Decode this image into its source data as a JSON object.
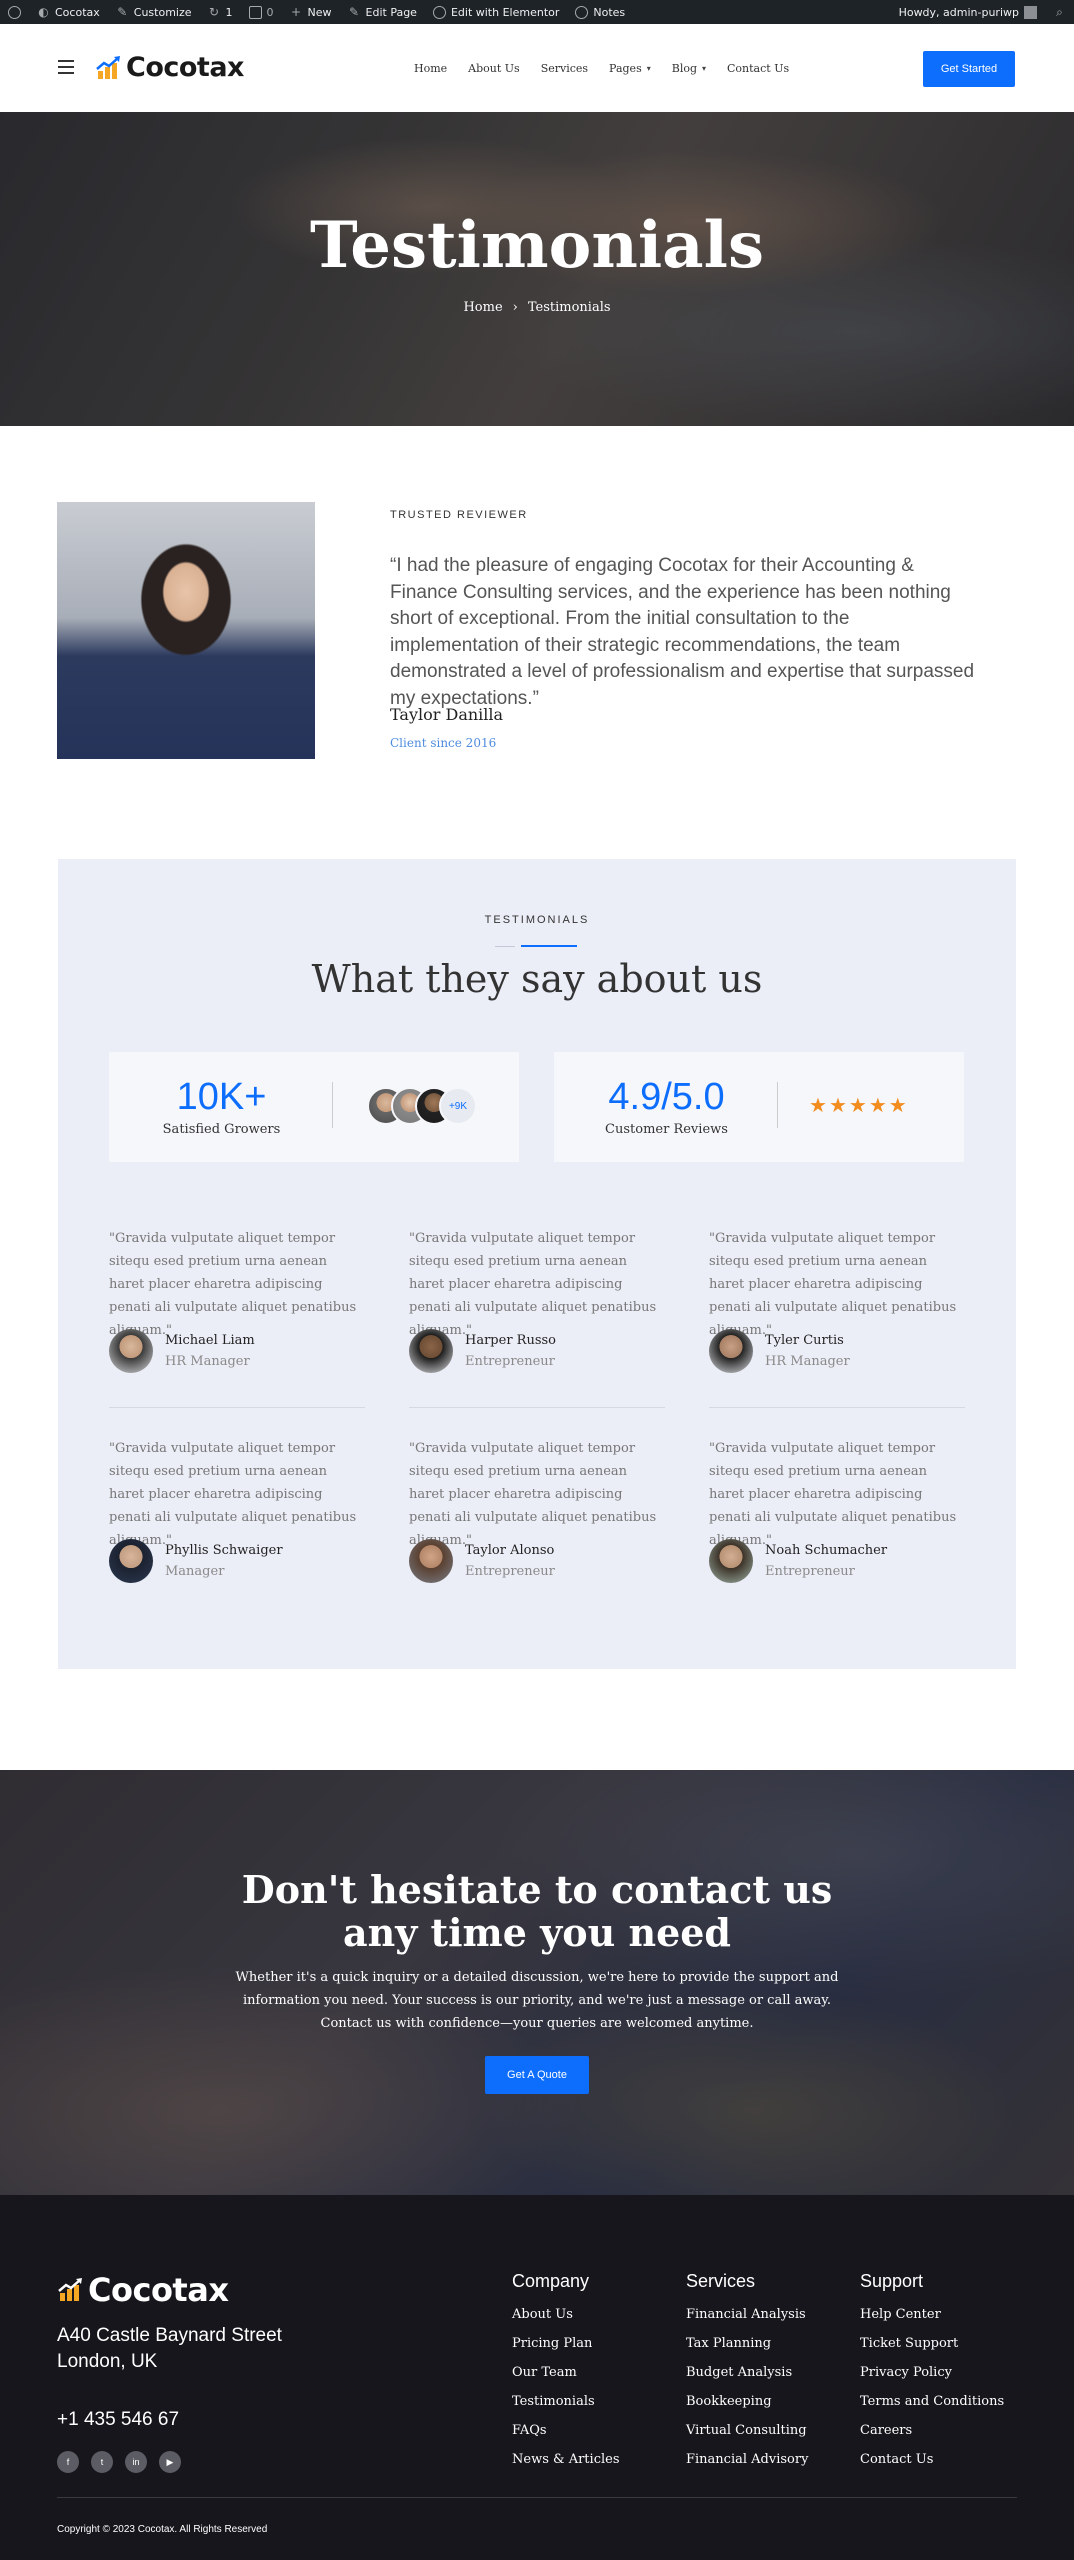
{
  "admin_bar": {
    "site_name": "Cocotax",
    "customize": "Customize",
    "updates_count": "1",
    "comments_count": "0",
    "new_label": "New",
    "edit_page": "Edit Page",
    "edit_elementor": "Edit with Elementor",
    "notes": "Notes",
    "howdy": "Howdy, admin-puriwp"
  },
  "header": {
    "logo_text": "Cocotax",
    "nav": [
      {
        "label": "Home",
        "dropdown": false
      },
      {
        "label": "About Us",
        "dropdown": false
      },
      {
        "label": "Services",
        "dropdown": false
      },
      {
        "label": "Pages",
        "dropdown": true
      },
      {
        "label": "Blog",
        "dropdown": true
      },
      {
        "label": "Contact Us",
        "dropdown": false
      }
    ],
    "cta_label": "Get Started",
    "accent": "#0d6efd"
  },
  "hero": {
    "title": "Testimonials",
    "breadcrumb_home": "Home",
    "breadcrumb_sep": "›",
    "breadcrumb_current": "Testimonials"
  },
  "reviewer": {
    "label": "TRUSTED REVIEWER",
    "quote": "“I had the pleasure of engaging Cocotax for their Accounting & Finance Consulting services, and the experience has been nothing short of exceptional. From the initial consultation to the implementation of their strategic recommendations, the team demonstrated a level of professionalism and expertise that surpassed my expectations.”",
    "name": "Taylor Danilla",
    "since": "Client since 2016"
  },
  "testimonials": {
    "label": "TESTIMONIALS",
    "heading": "What they say about us",
    "stat1_value": "10K+",
    "stat1_label": "Satisfied Growers",
    "stat1_more": "+9K",
    "stat2_value": "4.9/5.0",
    "stat2_label": "Customer Reviews",
    "stat2_stars": 5,
    "cards": [
      {
        "quote": "\"Gravida vulputate aliquet tempor sitequ esed pretium urna aenean haret placer eharetra adipiscing penati ali vulputate aliquet penatibus aliquam.\"",
        "name": "Michael Liam",
        "role": "HR Manager"
      },
      {
        "quote": "\"Gravida vulputate aliquet tempor sitequ esed pretium urna aenean haret placer eharetra adipiscing penati ali vulputate aliquet penatibus aliquam.\"",
        "name": "Harper Russo",
        "role": "Entrepreneur"
      },
      {
        "quote": "\"Gravida vulputate aliquet tempor sitequ esed pretium urna aenean haret placer eharetra adipiscing penati ali vulputate aliquet penatibus aliquam.\"",
        "name": "Tyler Curtis",
        "role": "HR Manager"
      },
      {
        "quote": "\"Gravida vulputate aliquet tempor sitequ esed pretium urna aenean haret placer eharetra adipiscing penati ali vulputate aliquet penatibus aliquam.\"",
        "name": "Phyllis Schwaiger",
        "role": "Manager"
      },
      {
        "quote": "\"Gravida vulputate aliquet tempor sitequ esed pretium urna aenean haret placer eharetra adipiscing penati ali vulputate aliquet penatibus aliquam.\"",
        "name": "Taylor Alonso",
        "role": "Entrepreneur"
      },
      {
        "quote": "\"Gravida vulputate aliquet tempor sitequ esed pretium urna aenean haret placer eharetra adipiscing penati ali vulputate aliquet penatibus aliquam.\"",
        "name": "Noah Schumacher",
        "role": "Entrepreneur"
      }
    ]
  },
  "cta": {
    "title_line1": "Don't hesitate to contact us",
    "title_line2": "any time you need",
    "text": "Whether it's a quick inquiry or a detailed discussion, we're here to provide the support and information you need. Your success is our priority, and we're just a message or call away. Contact us with confidence—your queries are welcomed anytime.",
    "button": "Get A Quote"
  },
  "footer": {
    "logo_text": "Cocotax",
    "address_line1": "A40 Castle Baynard Street",
    "address_line2": "London, UK",
    "phone": "+1 435 546 67",
    "socials": [
      "facebook-icon",
      "twitter-icon",
      "linkedin-icon",
      "youtube-icon"
    ],
    "columns": [
      {
        "title": "Company",
        "links": [
          "About Us",
          "Pricing Plan",
          "Our Team",
          "Testimonials",
          "FAQs",
          "News & Articles"
        ]
      },
      {
        "title": "Services",
        "links": [
          "Financial Analysis",
          "Tax Planning",
          "Budget Analysis",
          "Bookkeeping",
          "Virtual Consulting",
          "Financial Advisory"
        ]
      },
      {
        "title": "Support",
        "links": [
          "Help Center",
          "Ticket Support",
          "Privacy Policy",
          "Terms and Conditions",
          "Careers",
          "Contact Us"
        ]
      }
    ],
    "copyright": "Copyright © 2023 Cocotax. All Rights Reserved"
  }
}
